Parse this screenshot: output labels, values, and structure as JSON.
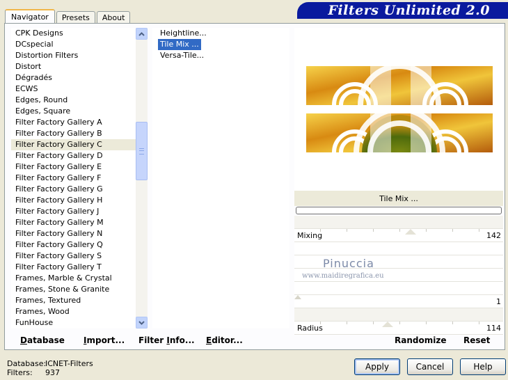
{
  "window": {
    "banner_title": "Filters Unlimited 2.0"
  },
  "tabs": [
    {
      "label": "Navigator",
      "active": true
    },
    {
      "label": "Presets",
      "active": false
    },
    {
      "label": "About",
      "active": false
    }
  ],
  "categories": [
    {
      "label": "CPK Designs"
    },
    {
      "label": "DCspecial"
    },
    {
      "label": "Distortion Filters"
    },
    {
      "label": "Distort"
    },
    {
      "label": "Dégradés"
    },
    {
      "label": "ECWS"
    },
    {
      "label": "Edges, Round"
    },
    {
      "label": "Edges, Square"
    },
    {
      "label": "Filter Factory Gallery A"
    },
    {
      "label": "Filter Factory Gallery B"
    },
    {
      "label": "Filter Factory Gallery C",
      "selected": true
    },
    {
      "label": "Filter Factory Gallery D"
    },
    {
      "label": "Filter Factory Gallery E"
    },
    {
      "label": "Filter Factory Gallery F"
    },
    {
      "label": "Filter Factory Gallery G"
    },
    {
      "label": "Filter Factory Gallery H"
    },
    {
      "label": "Filter Factory Gallery J"
    },
    {
      "label": "Filter Factory Gallery M"
    },
    {
      "label": "Filter Factory Gallery N"
    },
    {
      "label": "Filter Factory Gallery Q"
    },
    {
      "label": "Filter Factory Gallery S"
    },
    {
      "label": "Filter Factory Gallery T"
    },
    {
      "label": "Frames, Marble & Crystal"
    },
    {
      "label": "Frames, Stone & Granite"
    },
    {
      "label": "Frames, Textured"
    },
    {
      "label": "Frames, Wood"
    },
    {
      "label": "FunHouse"
    }
  ],
  "filters": [
    {
      "label": "Heightline..."
    },
    {
      "label": "Tile Mix ...",
      "selected": true
    },
    {
      "label": "Versa-Tile..."
    }
  ],
  "preview": {
    "filter_name": "Tile Mix ..."
  },
  "sliders": [
    {
      "label": "Mixing",
      "value": "142"
    },
    {
      "label": "",
      "value": ""
    },
    {
      "label": "",
      "value": ""
    },
    {
      "label": "",
      "value": ""
    },
    {
      "label": "",
      "value": ""
    },
    {
      "label": "",
      "value": "1"
    },
    {
      "label": "",
      "value": ""
    },
    {
      "label": "Radius",
      "value": "114"
    }
  ],
  "watermark": {
    "line1": "Pinuccia",
    "line2": "www.maidiregrafica.eu"
  },
  "toolbar": {
    "database": {
      "u": "D",
      "rest": "atabase"
    },
    "import": {
      "u": "I",
      "rest": "mport..."
    },
    "filter_info": {
      "pre": "Filter ",
      "u": "I",
      "rest": "nfo..."
    },
    "editor": {
      "u": "E",
      "rest": "ditor..."
    },
    "randomize": "Randomize",
    "reset": "Reset"
  },
  "status": {
    "database_label": "Database:",
    "database_value": "ICNET-Filters",
    "filters_label": "Filters:",
    "filters_value": "937"
  },
  "buttons": {
    "apply": "Apply",
    "cancel": "Cancel",
    "help": "Help"
  },
  "colors": {
    "banner": "#0a1a9e",
    "selection": "#316ac5",
    "tab_highlight": "#f1b74a"
  }
}
